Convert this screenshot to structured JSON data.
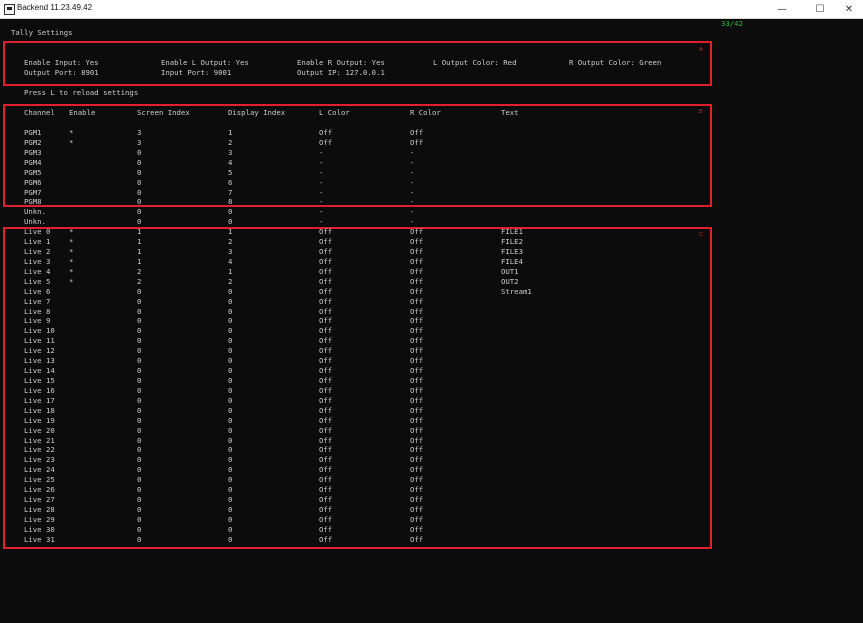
{
  "window": {
    "title": "Backend 11.23.49.42",
    "minimize": "—",
    "maximize": "☐",
    "close": "✕"
  },
  "counter": "33/42",
  "heading": "Tally Settings",
  "settings": {
    "enable_input": "Enable Input: Yes",
    "output_port": "Output Port: 8901",
    "enable_l_output": "Enable L Output: Yes",
    "input_port": "Input Port: 9001",
    "enable_r_output": "Enable R Output: Yes",
    "output_ip": "Output IP: 127.0.0.1",
    "l_output_color": "L Output Color: Red",
    "r_output_color": "R Output Color: Green"
  },
  "reload_hint": "Press L to reload settings",
  "annotations": {
    "a": "A",
    "b": "B",
    "c": "C"
  },
  "columns": [
    "Channel",
    "Enable",
    "Screen Index",
    "Display Index",
    "L Color",
    "R Color",
    "Text"
  ],
  "rows": [
    [
      "PGM1",
      "*",
      "3",
      "1",
      "Off",
      "Off",
      ""
    ],
    [
      "PGM2",
      "*",
      "3",
      "2",
      "Off",
      "Off",
      ""
    ],
    [
      "PGM3",
      "",
      "0",
      "3",
      "-",
      "-",
      ""
    ],
    [
      "PGM4",
      "",
      "0",
      "4",
      "-",
      "-",
      ""
    ],
    [
      "PGM5",
      "",
      "0",
      "5",
      "-",
      "-",
      ""
    ],
    [
      "PGM6",
      "",
      "0",
      "6",
      "-",
      "-",
      ""
    ],
    [
      "PGM7",
      "",
      "0",
      "7",
      "-",
      "-",
      ""
    ],
    [
      "PGM8",
      "",
      "0",
      "8",
      "-",
      "-",
      ""
    ],
    [
      "Unkn.",
      "",
      "0",
      "0",
      "-",
      "-",
      ""
    ],
    [
      "Unkn.",
      "",
      "0",
      "0",
      "-",
      "-",
      ""
    ],
    [
      "Live 0",
      "*",
      "1",
      "1",
      "Off",
      "Off",
      "FILE1"
    ],
    [
      "Live 1",
      "*",
      "1",
      "2",
      "Off",
      "Off",
      "FILE2"
    ],
    [
      "Live 2",
      "*",
      "1",
      "3",
      "Off",
      "Off",
      "FILE3"
    ],
    [
      "Live 3",
      "*",
      "1",
      "4",
      "Off",
      "Off",
      "FILE4"
    ],
    [
      "Live 4",
      "*",
      "2",
      "1",
      "Off",
      "Off",
      "OUT1"
    ],
    [
      "Live 5",
      "*",
      "2",
      "2",
      "Off",
      "Off",
      "OUT2"
    ],
    [
      "Live 6",
      "",
      "0",
      "0",
      "Off",
      "Off",
      "Stream1"
    ],
    [
      "Live 7",
      "",
      "0",
      "0",
      "Off",
      "Off",
      ""
    ],
    [
      "Live 8",
      "",
      "0",
      "0",
      "Off",
      "Off",
      ""
    ],
    [
      "Live 9",
      "",
      "0",
      "0",
      "Off",
      "Off",
      ""
    ],
    [
      "Live 10",
      "",
      "0",
      "0",
      "Off",
      "Off",
      ""
    ],
    [
      "Live 11",
      "",
      "0",
      "0",
      "Off",
      "Off",
      ""
    ],
    [
      "Live 12",
      "",
      "0",
      "0",
      "Off",
      "Off",
      ""
    ],
    [
      "Live 13",
      "",
      "0",
      "0",
      "Off",
      "Off",
      ""
    ],
    [
      "Live 14",
      "",
      "0",
      "0",
      "Off",
      "Off",
      ""
    ],
    [
      "Live 15",
      "",
      "0",
      "0",
      "Off",
      "Off",
      ""
    ],
    [
      "Live 16",
      "",
      "0",
      "0",
      "Off",
      "Off",
      ""
    ],
    [
      "Live 17",
      "",
      "0",
      "0",
      "Off",
      "Off",
      ""
    ],
    [
      "Live 18",
      "",
      "0",
      "0",
      "Off",
      "Off",
      ""
    ],
    [
      "Live 19",
      "",
      "0",
      "0",
      "Off",
      "Off",
      ""
    ],
    [
      "Live 20",
      "",
      "0",
      "0",
      "Off",
      "Off",
      ""
    ],
    [
      "Live 21",
      "",
      "0",
      "0",
      "Off",
      "Off",
      ""
    ],
    [
      "Live 22",
      "",
      "0",
      "0",
      "Off",
      "Off",
      ""
    ],
    [
      "Live 23",
      "",
      "0",
      "0",
      "Off",
      "Off",
      ""
    ],
    [
      "Live 24",
      "",
      "0",
      "0",
      "Off",
      "Off",
      ""
    ],
    [
      "Live 25",
      "",
      "0",
      "0",
      "Off",
      "Off",
      ""
    ],
    [
      "Live 26",
      "",
      "0",
      "0",
      "Off",
      "Off",
      ""
    ],
    [
      "Live 27",
      "",
      "0",
      "0",
      "Off",
      "Off",
      ""
    ],
    [
      "Live 28",
      "",
      "0",
      "0",
      "Off",
      "Off",
      ""
    ],
    [
      "Live 29",
      "",
      "0",
      "0",
      "Off",
      "Off",
      ""
    ],
    [
      "Live 30",
      "",
      "0",
      "0",
      "Off",
      "Off",
      ""
    ],
    [
      "Live 31",
      "",
      "0",
      "0",
      "Off",
      "Off",
      ""
    ]
  ]
}
